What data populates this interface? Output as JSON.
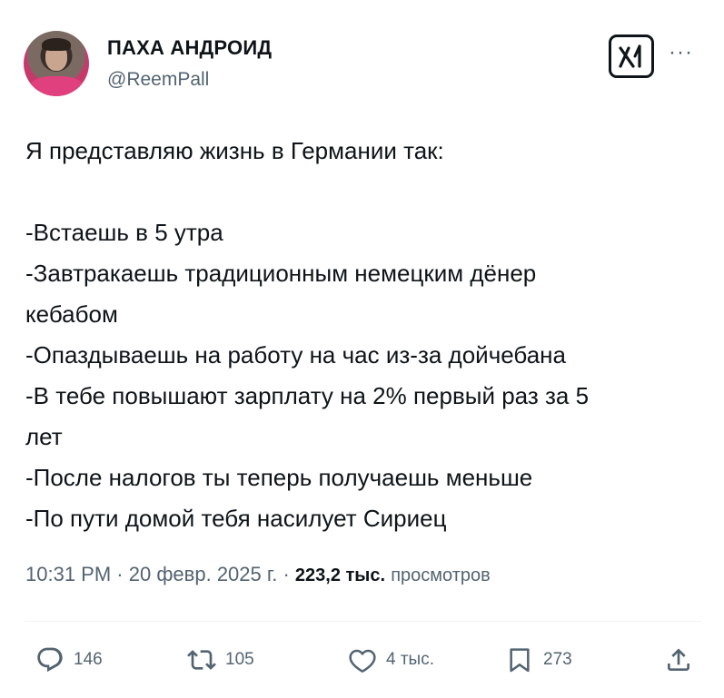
{
  "author": {
    "display_name": "ПАХА АНДРОИД",
    "handle": "@ReemPall"
  },
  "header": {
    "grok_icon": "grok-icon",
    "more_icon": "more-icon"
  },
  "tweet": {
    "lines": [
      "Я представляю жизнь в Германии так:",
      "",
      "-Встаешь в 5 утра",
      "-Завтракаешь традиционным немецким дёнер",
      "кебабом",
      "-Опаздываешь на работу на час из-за дойчебана",
      "-В тебе повышают зарплату на 2% первый раз за 5",
      "лет",
      "-После налогов ты теперь получаешь меньше",
      "-По пути домой тебя насилует Сириец"
    ]
  },
  "meta": {
    "time": "10:31 PM",
    "sep1": "·",
    "date": "20 февр. 2025 г.",
    "sep2": "·",
    "views_count": "223,2 тыс.",
    "views_label": "просмотров"
  },
  "actions": {
    "replies": "146",
    "reposts": "105",
    "likes": "4 тыс.",
    "bookmarks": "273"
  },
  "colors": {
    "text": "#0f1419",
    "secondary": "#536471",
    "divider": "#eff3f4"
  }
}
